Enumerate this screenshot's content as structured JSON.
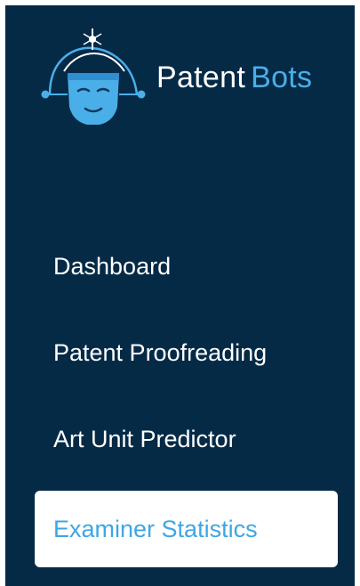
{
  "brand": {
    "name_first": "Patent",
    "name_second": "Bots",
    "logo_icon": "robot-head-logo-icon"
  },
  "colors": {
    "sidebar_bg": "#052a46",
    "accent": "#4aaee8",
    "active_text": "#3ea6e4",
    "active_bg": "#ffffff",
    "text": "#ffffff"
  },
  "nav": {
    "items": [
      {
        "label": "Dashboard",
        "active": false
      },
      {
        "label": "Patent Proofreading",
        "active": false
      },
      {
        "label": "Art Unit Predictor",
        "active": false
      },
      {
        "label": "Examiner Statistics",
        "active": true
      }
    ]
  }
}
